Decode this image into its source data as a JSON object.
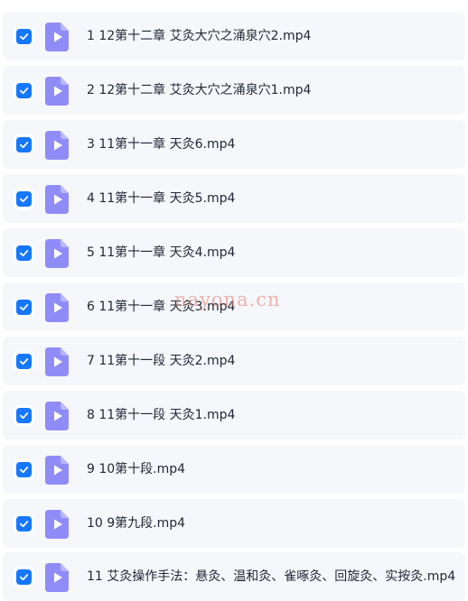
{
  "files": [
    {
      "name": "1 12第十二章 艾灸大穴之涌泉穴2.mp4",
      "checked": true,
      "icon": "video-file-icon"
    },
    {
      "name": "2 12第十二章 艾灸大穴之涌泉穴1.mp4",
      "checked": true,
      "icon": "video-file-icon"
    },
    {
      "name": "3 11第十一章 天灸6.mp4",
      "checked": true,
      "icon": "video-file-icon"
    },
    {
      "name": "4 11第十一章 天灸5.mp4",
      "checked": true,
      "icon": "video-file-icon"
    },
    {
      "name": "5 11第十一章 天灸4.mp4",
      "checked": true,
      "icon": "video-file-icon"
    },
    {
      "name": "6 11第十一章 天灸3.mp4",
      "checked": true,
      "icon": "video-file-icon"
    },
    {
      "name": "7 11第十一段 天灸2.mp4",
      "checked": true,
      "icon": "video-file-icon"
    },
    {
      "name": "8 11第十一段 天灸1.mp4",
      "checked": true,
      "icon": "video-file-icon"
    },
    {
      "name": "9 10第十段.mp4",
      "checked": true,
      "icon": "video-file-icon"
    },
    {
      "name": "10 9第九段.mp4",
      "checked": true,
      "icon": "video-file-icon"
    },
    {
      "name": "11 艾灸操作手法：悬灸、温和灸、雀啄灸、回旋灸、实按灸.mp4",
      "checked": true,
      "icon": "video-file-icon"
    }
  ],
  "watermark": "nayona.cn",
  "colors": {
    "checkbox": "#1677ff",
    "file_icon": "#8f8cf7",
    "row_background": "#f6f7fa"
  }
}
